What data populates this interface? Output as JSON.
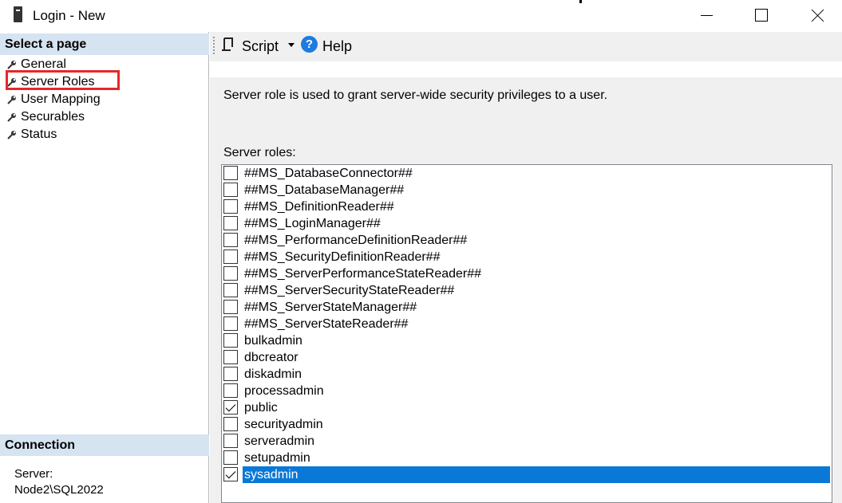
{
  "window": {
    "title": "Login - New",
    "icon": "server-icon"
  },
  "left_pane": {
    "select_header": "Select a page",
    "pages": [
      {
        "label": "General"
      },
      {
        "label": "Server Roles"
      },
      {
        "label": "User Mapping"
      },
      {
        "label": "Securables"
      },
      {
        "label": "Status"
      }
    ],
    "highlighted_page": "Server Roles",
    "connection_header": "Connection",
    "server_label": "Server:",
    "server_value": "Node2\\SQL2022"
  },
  "toolbar": {
    "script_label": "Script",
    "help_label": "Help"
  },
  "main": {
    "description": "Server role is used to grant server-wide security privileges to a user.",
    "roles_label": "Server roles:",
    "roles": [
      {
        "name": "##MS_DatabaseConnector##",
        "checked": false
      },
      {
        "name": "##MS_DatabaseManager##",
        "checked": false
      },
      {
        "name": "##MS_DefinitionReader##",
        "checked": false
      },
      {
        "name": "##MS_LoginManager##",
        "checked": false
      },
      {
        "name": "##MS_PerformanceDefinitionReader##",
        "checked": false
      },
      {
        "name": "##MS_SecurityDefinitionReader##",
        "checked": false
      },
      {
        "name": "##MS_ServerPerformanceStateReader##",
        "checked": false
      },
      {
        "name": "##MS_ServerSecurityStateReader##",
        "checked": false
      },
      {
        "name": "##MS_ServerStateManager##",
        "checked": false
      },
      {
        "name": "##MS_ServerStateReader##",
        "checked": false
      },
      {
        "name": "bulkadmin",
        "checked": false
      },
      {
        "name": "dbcreator",
        "checked": false
      },
      {
        "name": "diskadmin",
        "checked": false
      },
      {
        "name": "processadmin",
        "checked": false
      },
      {
        "name": "public",
        "checked": true
      },
      {
        "name": "securityadmin",
        "checked": false
      },
      {
        "name": "serveradmin",
        "checked": false
      },
      {
        "name": "setupadmin",
        "checked": false
      },
      {
        "name": "sysadmin",
        "checked": true,
        "selected": true
      }
    ]
  },
  "colors": {
    "selection": "#0a78d7",
    "section_header": "#d6e3f1",
    "highlight_box": "#e8262a"
  }
}
